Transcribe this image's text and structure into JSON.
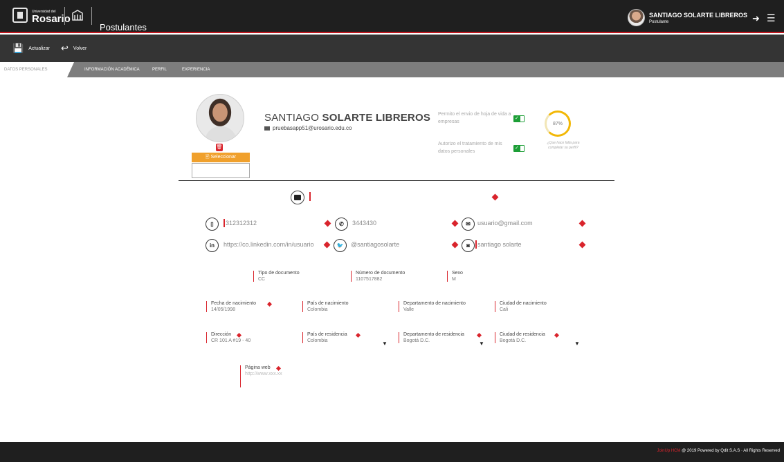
{
  "header": {
    "logo_small": "Universidad del",
    "logo_big": "Rosario",
    "app_title": "Postulantes",
    "user_name": "SANTIAGO SOLARTE LIBREROS",
    "user_role": "Postulante"
  },
  "toolbar": {
    "update_label": "Actualizar",
    "back_label": "Volver"
  },
  "tabs": [
    {
      "label": "DATOS PERSONALES",
      "active": true
    },
    {
      "label": "INFORMACIÓN ACADÉMICA",
      "active": false
    },
    {
      "label": "PERFIL",
      "active": false
    },
    {
      "label": "EXPERIENCIA",
      "active": false
    }
  ],
  "profile": {
    "first_name": "SANTIAGO",
    "last_name": "SOLARTE LIBREROS",
    "email": "pruebasapp51@urosario.edu.co",
    "select_label": "Seleccionar",
    "permission_cv": "Permito el envio de hoja de vida a empresas",
    "permission_data": "Autorizo el tratamiento de mis datos personales",
    "completion": "87%",
    "completion_hint": "¿Que hace falta para completar su perfil?"
  },
  "contacts": {
    "mobile": "312312312",
    "phone": "3443430",
    "email": "usuario@gmail.com",
    "linkedin": "https://co.linkedin.com/in/usuario",
    "twitter": "@santiagosolarte",
    "instagram": "santiago solarte"
  },
  "details": {
    "doc_type_label": "Tipo de documento",
    "doc_type_value": "CC",
    "doc_number_label": "Número de documento",
    "doc_number_value": "1107517882",
    "sex_label": "Sexo",
    "sex_value": "M",
    "birth_date_label": "Fecha de nacimiento",
    "birth_date_value": "14/05/1998",
    "birth_country_label": "País de nacimiento",
    "birth_country_value": "Colombia",
    "birth_dept_label": "Departamento de nacimiento",
    "birth_dept_value": "Valle",
    "birth_city_label": "Ciudad de nacimiento",
    "birth_city_value": "Cali",
    "address_label": "Dirección",
    "address_value": "CR 101 A #19 - 40",
    "res_country_label": "País de residencia",
    "res_country_value": "Colombia",
    "res_dept_label": "Departamento de residencia",
    "res_dept_value": "Bogotá D.C.",
    "res_city_label": "Ciudad de residencia",
    "res_city_value": "Bogotá D.C.",
    "web_label": "Página web",
    "web_value": "http://www.xxx.xx"
  },
  "footer": {
    "brand": "JoinUp HCM",
    "text": "@ 2019 Powered by Qdit S.A.S  ·  All Rights Reserved"
  },
  "colors": {
    "accent": "#d9242c",
    "orange": "#f0a02c",
    "green": "#1c9e36",
    "progress": "#f2b705"
  }
}
